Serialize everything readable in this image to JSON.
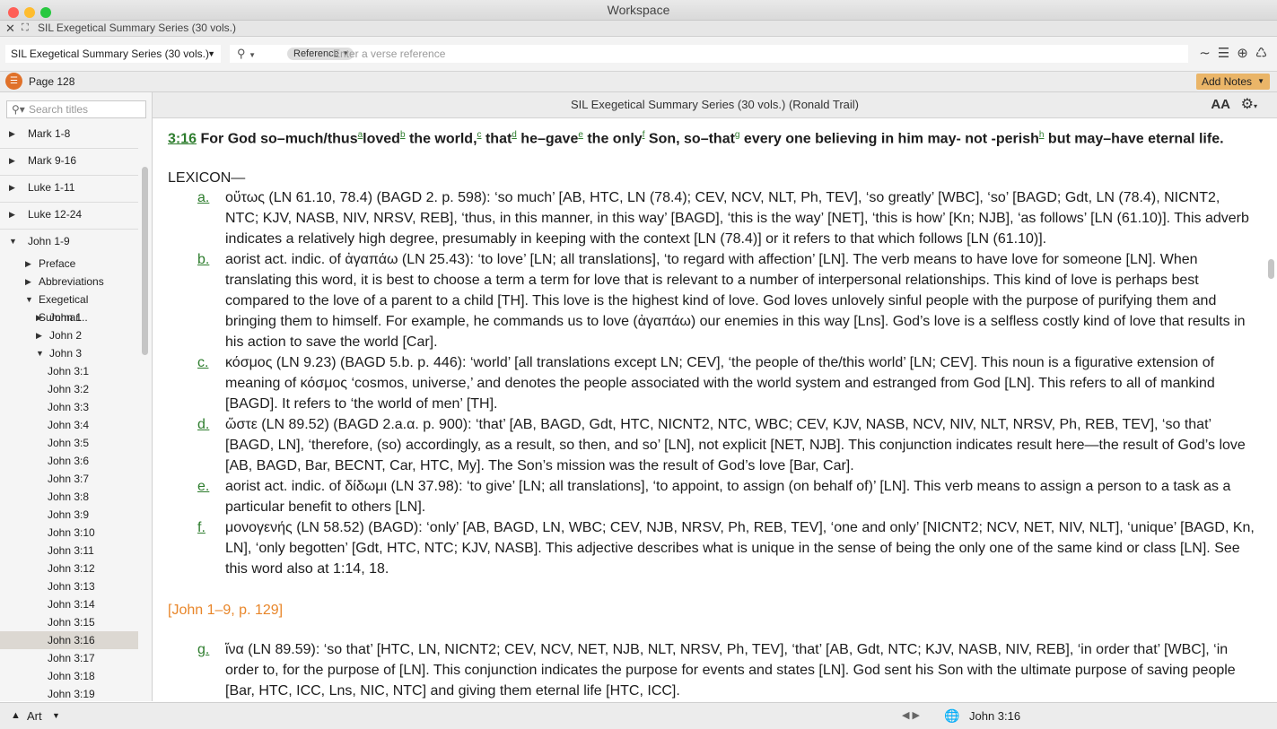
{
  "window": {
    "title": "Workspace",
    "colors": {
      "close": "#ff5f57",
      "min": "#febc2e",
      "max": "#28c840"
    }
  },
  "tabbar": {
    "close_glyph": "✕",
    "expand_glyph": "⛶",
    "tab_title": "SIL Exegetical Summary Series (30 vols.)"
  },
  "toolbar": {
    "resource": "SIL Exegetical Summary Series (30 vols.)",
    "search_glyph": "⚲",
    "mode": "Reference",
    "placeholder": "Enter a verse reference",
    "icons": [
      "∼",
      "☰",
      "⊕",
      "♺"
    ]
  },
  "pagebar": {
    "page": "Page 128",
    "add_notes": "Add Notes",
    "accent": "#e0712a"
  },
  "sidebar": {
    "search_placeholder": "Search titles",
    "items": [
      {
        "label": "Mark 1-8",
        "twisty": "▶"
      },
      {
        "label": "Mark 9-16",
        "twisty": "▶"
      },
      {
        "label": "Luke 1-11",
        "twisty": "▶"
      },
      {
        "label": "Luke 12-24",
        "twisty": "▶"
      },
      {
        "label": "John 1-9",
        "twisty": "▼"
      },
      {
        "label": "Preface",
        "twisty": "▶"
      },
      {
        "label": "Abbreviations",
        "twisty": "▶"
      },
      {
        "label": "Exegetical Summar...",
        "twisty": "▼"
      },
      {
        "label": "John 1",
        "twisty": "▶"
      },
      {
        "label": "John 2",
        "twisty": "▶"
      },
      {
        "label": "John 3",
        "twisty": "▼"
      },
      {
        "label": "John 3:1"
      },
      {
        "label": "John 3:2"
      },
      {
        "label": "John 3:3"
      },
      {
        "label": "John 3:4"
      },
      {
        "label": "John 3:5"
      },
      {
        "label": "John 3:6"
      },
      {
        "label": "John 3:7"
      },
      {
        "label": "John 3:8"
      },
      {
        "label": "John 3:9"
      },
      {
        "label": "John 3:10"
      },
      {
        "label": "John 3:11"
      },
      {
        "label": "John 3:12"
      },
      {
        "label": "John 3:13"
      },
      {
        "label": "John 3:14"
      },
      {
        "label": "John 3:15"
      },
      {
        "label": "John 3:16",
        "selected": true
      },
      {
        "label": "John 3:17"
      },
      {
        "label": "John 3:18"
      },
      {
        "label": "John 3:19"
      }
    ]
  },
  "main": {
    "header": "SIL Exegetical Summary Series (30 vols.) (Ronald Trail)",
    "text_size": "AA",
    "gear": "⚙",
    "verse": {
      "ref": "3:16",
      "segments": [
        " For God so–much/thus",
        "a",
        "loved",
        "b",
        " the world,",
        "c",
        " that",
        "d",
        " he–gave",
        "e",
        " the only",
        "f",
        " Son, so–that",
        "g",
        " every one believing in him may- not -perish",
        "h",
        " but may–have eternal life."
      ]
    },
    "lexicon_heading": "LEXICON—",
    "entries": [
      {
        "letter": "a.",
        "text": "οὕτως (LN 61.10, 78.4) (BAGD 2. p. 598): ‘so much’ [AB, HTC, LN (78.4); CEV, NCV, NLT, Ph, TEV], ‘so greatly’ [WBC], ‘so’ [BAGD; Gdt, LN (78.4), NICNT2, NTC; KJV, NASB, NIV, NRSV, REB], ‘thus, in this manner, in this way’ [BAGD], ‘this is the way’ [NET], ‘this is how’ [Kn; NJB], ‘as follows’ [LN (61.10)]. This adverb indicates a relatively high degree, presumably in keeping with the context [LN (78.4)] or it refers to that which follows [LN (61.10)]."
      },
      {
        "letter": "b.",
        "text": "aorist act. indic. of ἀγαπάω (LN 25.43): ‘to love’ [LN; all translations], ‘to regard with affection’ [LN]. The verb means to have love for someone [LN]. When translating this word, it is best to choose a term a term for love that is relevant to a number of interpersonal relationships. This kind of love is perhaps best compared to the love of a parent to a child [TH]. This love is the highest kind of love. God loves unlovely sinful people with the purpose of purifying them and bringing them to himself. For example, he commands us to love (ἀγαπάω) our enemies in this way [Lns]. God’s love is a selfless costly kind of love that results in his action to save the world [Car]."
      },
      {
        "letter": "c.",
        "text": "κόσμος (LN 9.23) (BAGD 5.b. p. 446): ‘world’ [all translations except LN; CEV], ‘the people of the/this world’ [LN; CEV]. This noun is a figurative extension of meaning of κόσμος ‘cosmos, universe,’ and denotes the people associated with the world system and estranged from God [LN]. This refers to all of mankind [BAGD]. It refers to ‘the world of men’ [TH]."
      },
      {
        "letter": "d.",
        "text": "ὥστε (LN 89.52) (BAGD 2.a.α. p. 900): ‘that’ [AB, BAGD, Gdt, HTC, NICNT2, NTC, WBC; CEV, KJV, NASB, NCV, NIV, NLT, NRSV, Ph, REB, TEV], ‘so that’ [BAGD, LN], ‘therefore, (so) accordingly, as a result, so then, and so’ [LN], not explicit [NET, NJB]. This conjunction indicates result here—the result of God’s love [AB, BAGD, Bar, BECNT, Car, HTC, My]. The Son’s mission was the result of God’s love [Bar, Car]."
      },
      {
        "letter": "e.",
        "text": "aorist act. indic. of δίδωμι (LN 37.98): ‘to give’ [LN; all translations], ‘to appoint, to assign (on behalf of)’ [LN]. This verb means to assign a person to a task as a particular benefit to others [LN]."
      },
      {
        "letter": "f.",
        "text": "μονογενής (LN 58.52) (BAGD): ‘only’ [AB, BAGD, LN, WBC; CEV, NJB, NRSV, Ph, REB, TEV], ‘one and only’ [NICNT2; NCV, NET, NIV, NLT], ‘unique’ [BAGD, Kn, LN], ‘only begotten’ [Gdt, HTC, NTC; KJV, NASB]. This adjective describes what is unique in the sense of being the only one of the same kind or class [LN]. See this word also at 1:14, 18."
      }
    ],
    "page_marker": "[John 1–9, p. 129]",
    "entry_g": {
      "letter": "g.",
      "text": "ἵνα (LN 89.59): ‘so that’ [HTC, LN, NICNT2; CEV, NCV, NET, NJB, NLT, NRSV, Ph, TEV], ‘that’ [AB, Gdt, NTC; KJV, NASB, NIV, REB], ‘in order that’ [WBC], ‘in order to, for the purpose of [LN]. This conjunction indicates the purpose for events and states [LN]. God sent his Son with the ultimate purpose of saving people [Bar, HTC, ICC, Lns, NIC, NTC] and giving them eternal life [HTC, ICC]."
    }
  },
  "bottombar": {
    "up_glyph": "▲",
    "layout": "Art",
    "caret": "▼",
    "nav": "◀   ▶",
    "globe": "🌐",
    "location": "John 3:16"
  }
}
